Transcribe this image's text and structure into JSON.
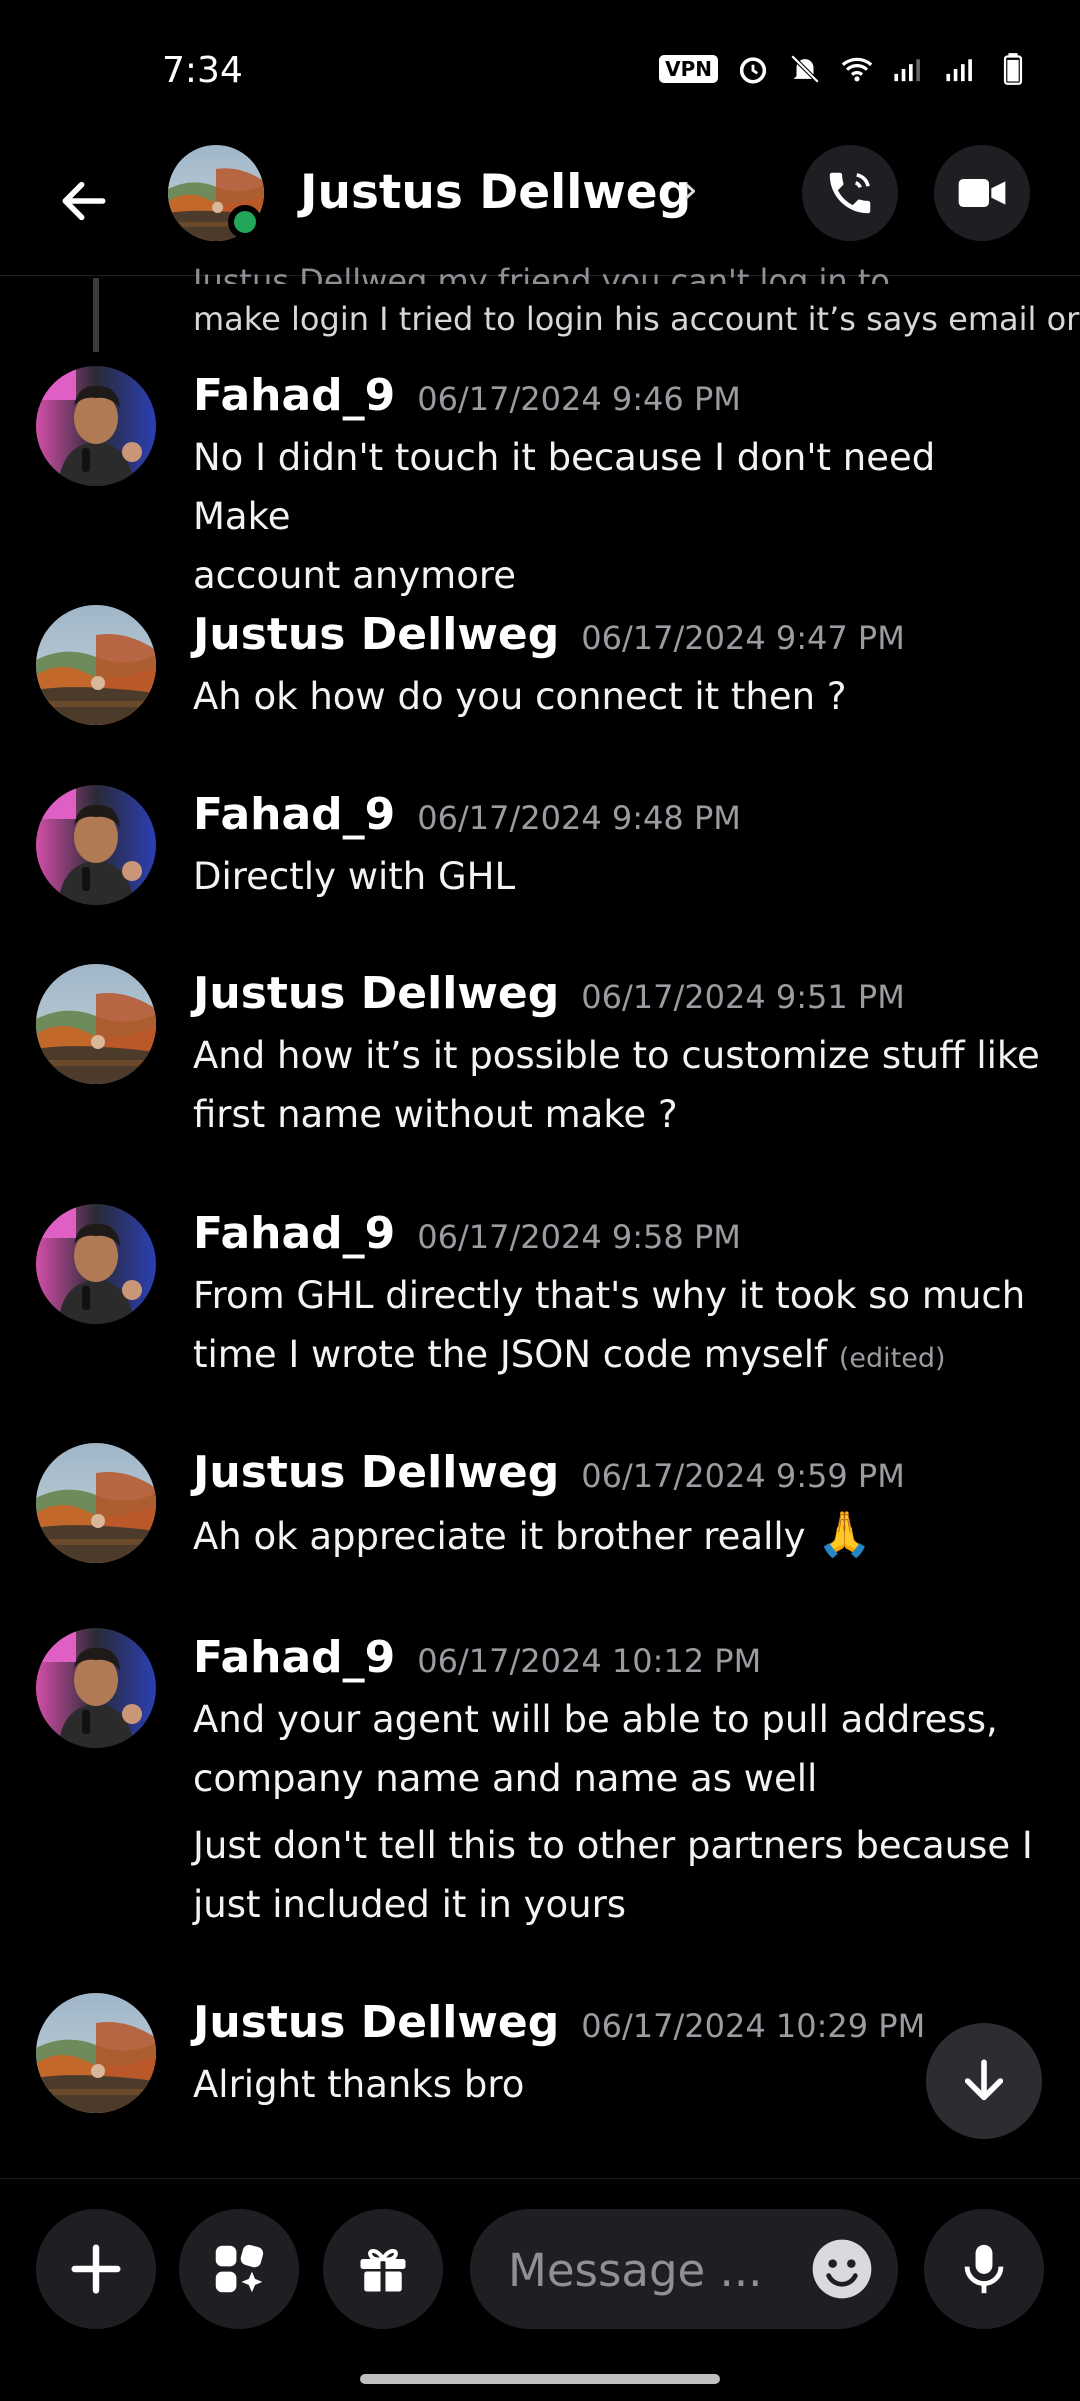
{
  "status": {
    "time": "7:34",
    "vpn": "VPN"
  },
  "header": {
    "name": "Justus Dellweg",
    "chevron": "›"
  },
  "reply": {
    "cut_text": "Justus Dellweg my friend you can't log in to",
    "text": "make login I tried to login his account it’s says email or"
  },
  "messages": [
    {
      "author": "Fahad_9",
      "timestamp": "06/17/2024 9:46 PM",
      "lines": [
        "No I didn't touch it because I don't need Make",
        "account anymore"
      ]
    },
    {
      "author": "Justus Dellweg",
      "timestamp": "06/17/2024 9:47 PM",
      "lines": [
        "Ah ok how do you connect it then ?"
      ]
    },
    {
      "author": "Fahad_9",
      "timestamp": "06/17/2024 9:48 PM",
      "lines": [
        "Directly with GHL"
      ]
    },
    {
      "author": "Justus Dellweg",
      "timestamp": "06/17/2024 9:51 PM",
      "lines": [
        "And how it’s it possible to customize stuff like",
        "first name without make ?"
      ]
    },
    {
      "author": "Fahad_9",
      "timestamp": "06/17/2024 9:58 PM",
      "lines": [
        "From GHL directly that's why it took so much",
        "time I wrote the JSON code myself"
      ],
      "edited": "(edited)"
    },
    {
      "author": "Justus Dellweg",
      "timestamp": "06/17/2024 9:59 PM",
      "lines": [
        "Ah ok appreciate it brother really"
      ],
      "emoji": "🙏"
    },
    {
      "author": "Fahad_9",
      "timestamp": "06/17/2024 10:12 PM",
      "lines": [
        "And your agent will be able to pull address,",
        "company name and name as well"
      ],
      "extra_lines": [
        "Just don't tell this to other partners because I",
        "just included it in yours"
      ]
    },
    {
      "author": "Justus Dellweg",
      "timestamp": "06/17/2024 10:29 PM",
      "lines": [
        "Alright thanks bro"
      ]
    }
  ],
  "input": {
    "placeholder": "Message ..."
  },
  "colors": {
    "background": "#000000",
    "online": "#23a55a",
    "button_bg": "#1e1f22",
    "timestamp": "#9b9ca1"
  }
}
